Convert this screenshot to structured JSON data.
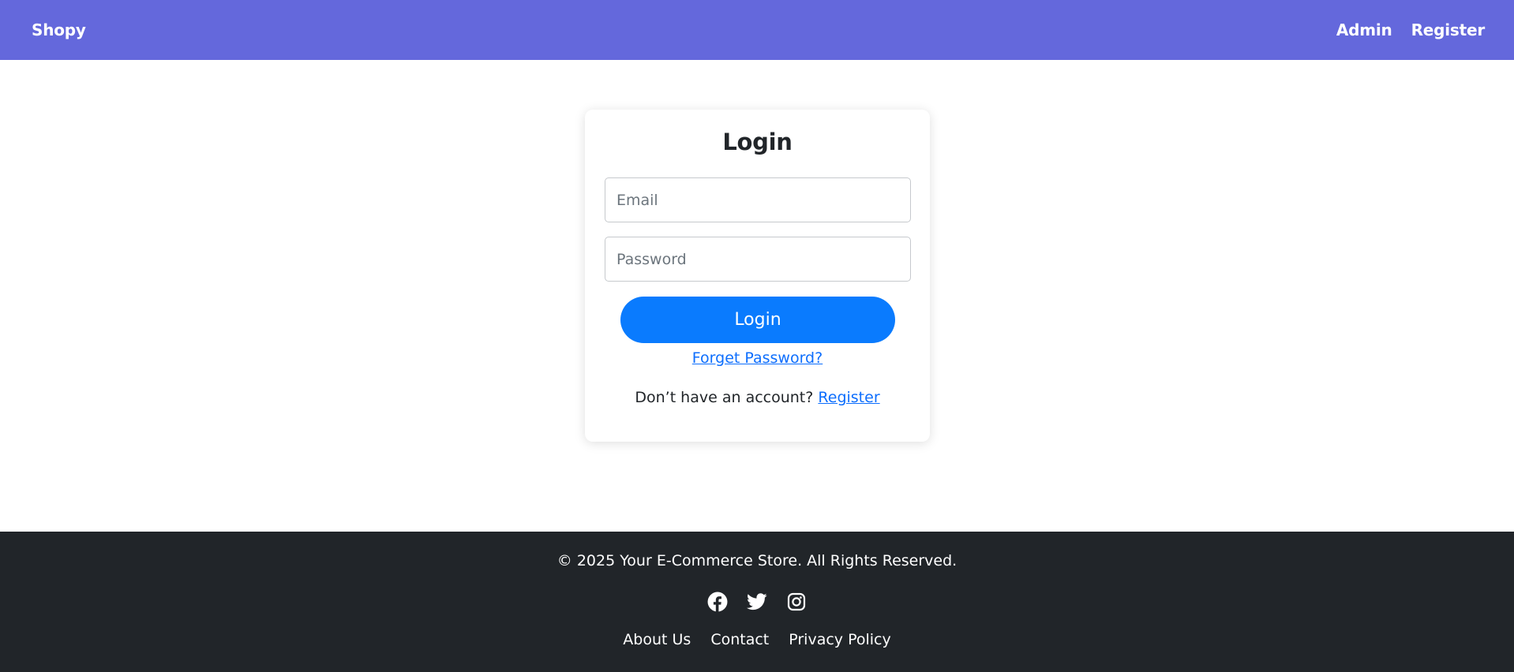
{
  "navbar": {
    "brand": "Shopy",
    "links": [
      {
        "label": "Admin"
      },
      {
        "label": "Register"
      }
    ],
    "background": "#6468dc"
  },
  "login": {
    "title": "Login",
    "email_placeholder": "Email",
    "password_placeholder": "Password",
    "submit_label": "Login",
    "forgot_label": "Forget Password?",
    "register_prompt": "Don’t have an account?",
    "register_link": "Register",
    "button_color": "#0a7bfe"
  },
  "footer": {
    "copyright": "© 2025 Your E-Commerce Store. All Rights Reserved.",
    "social_icons": [
      "facebook-icon",
      "twitter-icon",
      "instagram-icon"
    ],
    "links": [
      {
        "label": "About Us"
      },
      {
        "label": "Contact"
      },
      {
        "label": "Privacy Policy"
      }
    ],
    "background": "#212529"
  }
}
